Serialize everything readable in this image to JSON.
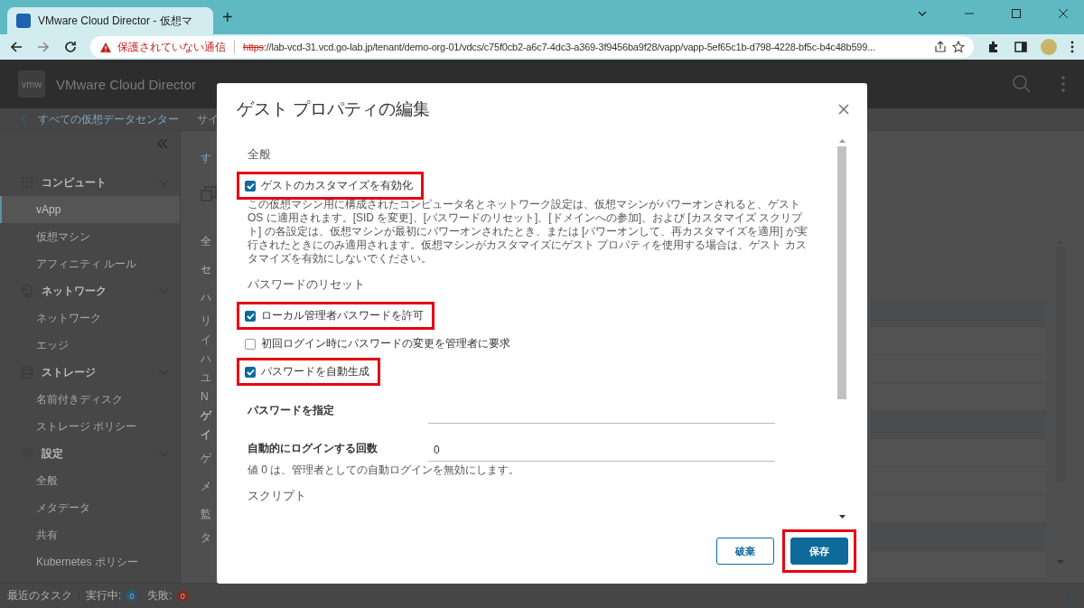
{
  "browser": {
    "tab_title": "VMware Cloud Director - 仮想マ",
    "new_tab": "+",
    "security": "保護されていない通信",
    "url_scheme": "https",
    "url_rest": "://lab-vcd-31.vcd.go-lab.jp/tenant/demo-org-01/vdcs/c75f0cb2-a6c7-4dc3-a369-3f9456ba9f28/vapp/vapp-5ef65c1b-d798-4228-bf5c-b4c48b599..."
  },
  "app": {
    "logo": "vmw",
    "name": "VMware Cloud Director"
  },
  "sidebar": {
    "back": "すべての仮想データセンター",
    "groups": [
      {
        "label": "コンピュート",
        "expanded": true,
        "items": [
          {
            "label": "vApp",
            "selected": true
          },
          {
            "label": "仮想マシン",
            "selected": false
          },
          {
            "label": "アフィニティ ルール",
            "selected": false
          }
        ]
      },
      {
        "label": "ネットワーク",
        "expanded": true,
        "items": [
          {
            "label": "ネットワーク",
            "selected": false
          },
          {
            "label": "エッジ",
            "selected": false
          }
        ]
      },
      {
        "label": "ストレージ",
        "expanded": true,
        "items": [
          {
            "label": "名前付きディスク",
            "selected": false
          },
          {
            "label": "ストレージ ポリシー",
            "selected": false
          }
        ]
      },
      {
        "label": "設定",
        "expanded": true,
        "items": [
          {
            "label": "全般",
            "selected": false
          },
          {
            "label": "メタデータ",
            "selected": false
          },
          {
            "label": "共有",
            "selected": false
          },
          {
            "label": "Kubernetes ポリシー",
            "selected": false
          }
        ]
      }
    ]
  },
  "breadcrumb": "サイ",
  "content_fragments": [
    {
      "text": "す",
      "kind": "link"
    },
    {
      "text": "全",
      "kind": "label"
    },
    {
      "text": "セ",
      "kind": "label"
    },
    {
      "text": "ハ",
      "kind": "label"
    },
    {
      "text": "リ",
      "kind": "sub"
    },
    {
      "text": "イ",
      "kind": "sub"
    },
    {
      "text": "ハ",
      "kind": "sub"
    },
    {
      "text": "ユ",
      "kind": "sub"
    },
    {
      "text": "N",
      "kind": "sub"
    },
    {
      "text": "ゲ",
      "kind": "heading"
    },
    {
      "text": "イ",
      "kind": "heading"
    },
    {
      "text": "ゲ",
      "kind": "label"
    },
    {
      "text": "メ",
      "kind": "label"
    },
    {
      "text": "監",
      "kind": "label"
    },
    {
      "text": "タ",
      "kind": "sub"
    }
  ],
  "dialog": {
    "title": "ゲスト プロパティの編集",
    "sections": [
      {
        "heading": "全般",
        "items": [
          {
            "kind": "checkbox",
            "label": "ゲストのカスタマイズを有効化",
            "checked": true,
            "highlighted": true
          },
          {
            "kind": "note",
            "text": "この仮想マシン用に構成されたコンピュータ名とネットワーク設定は、仮想マシンがパワーオンされると、ゲスト OS に適用されます。[SID を変更]、[パスワードのリセット]、[ドメインへの参加]、および [カスタマイズ スクリプト] の各設定は、仮想マシンが最初にパワーオンされたとき、または [パワーオンして、再カスタマイズを適用] が実行されたときにのみ適用されます。仮想マシンがカスタマイズにゲスト プロパティを使用する場合は、ゲスト カスタマイズを有効にしないでください。"
          }
        ]
      },
      {
        "heading": "パスワードのリセット",
        "items": [
          {
            "kind": "checkbox",
            "label": "ローカル管理者パスワードを許可",
            "checked": true,
            "highlighted": true
          },
          {
            "kind": "checkbox",
            "label": "初回ログイン時にパスワードの変更を管理者に要求",
            "checked": false,
            "highlighted": false
          },
          {
            "kind": "checkbox",
            "label": "パスワードを自動生成",
            "checked": true,
            "highlighted": true
          },
          {
            "kind": "field",
            "label": "パスワードを指定"
          },
          {
            "kind": "field",
            "label": "自動的にログインする回数",
            "value": "0"
          },
          {
            "kind": "note",
            "text": "値 0 は、管理者としての自動ログインを無効にします。"
          }
        ]
      },
      {
        "heading": "スクリプト"
      }
    ],
    "buttons": [
      {
        "label": "破棄",
        "kind": "secondary",
        "highlighted": false
      },
      {
        "label": "保存",
        "kind": "primary",
        "highlighted": true
      }
    ]
  },
  "status_bar": {
    "label": "最近のタスク",
    "running_label": "実行中:",
    "running": "0",
    "failed_label": "失敗:",
    "failed": "0"
  }
}
